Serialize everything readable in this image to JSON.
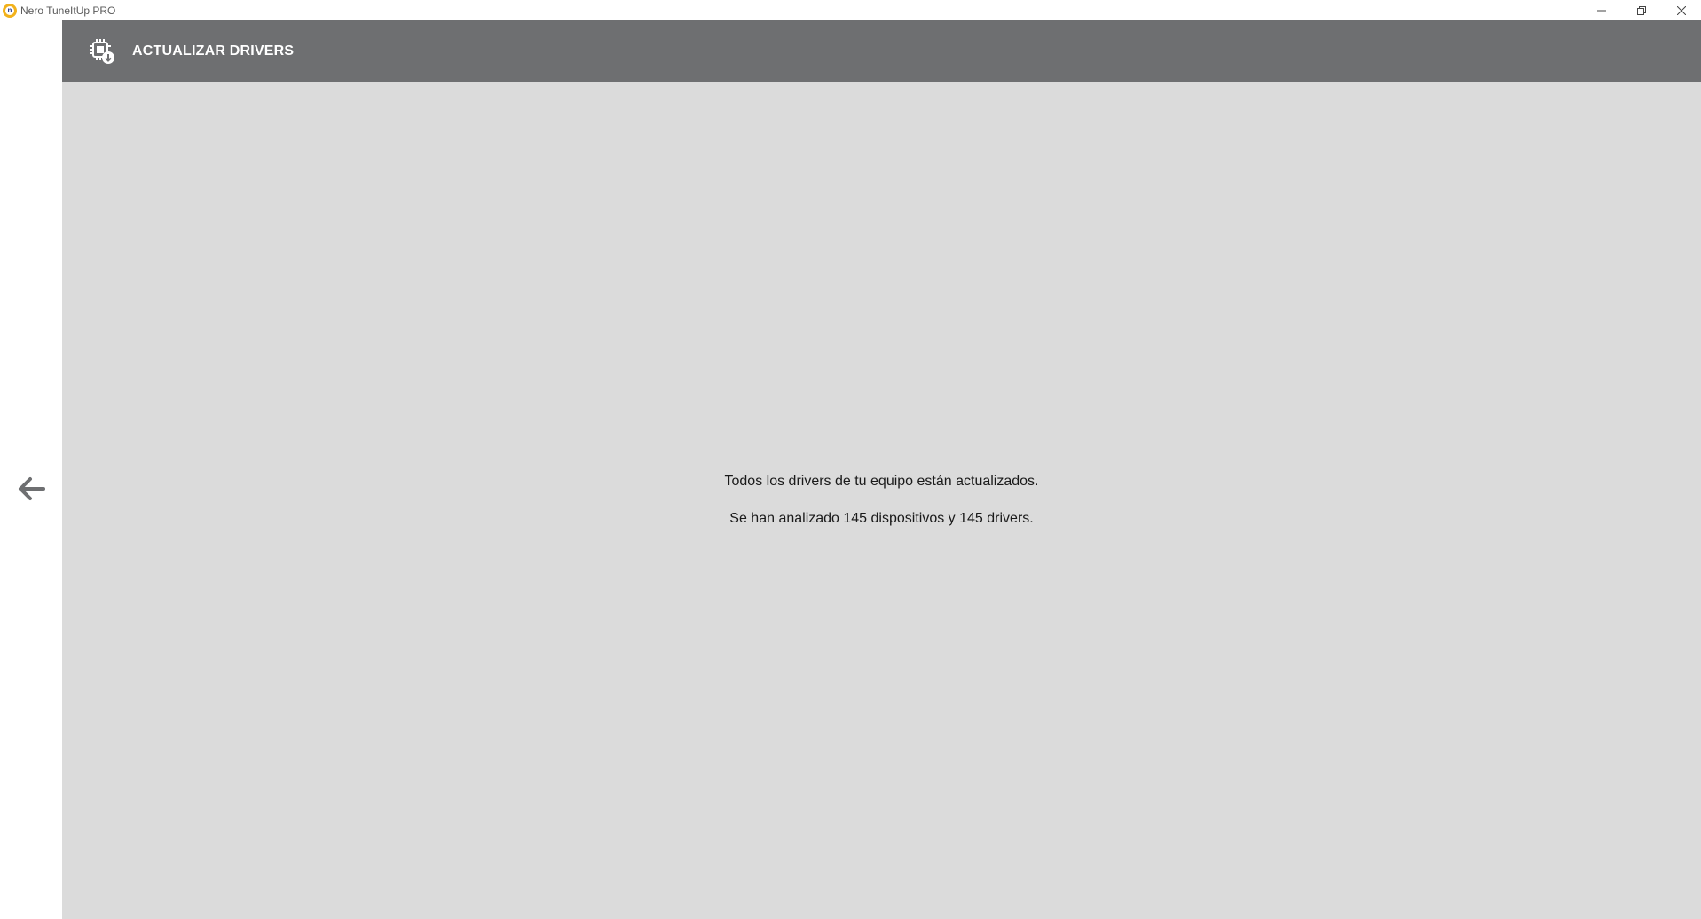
{
  "window": {
    "title": "Nero TuneItUp PRO",
    "controls": {
      "minimize": "minimize-icon",
      "restore": "restore-icon",
      "close": "close-icon"
    }
  },
  "header": {
    "title": "ACTUALIZAR DRIVERS",
    "icon": "driver-update-icon"
  },
  "navigation": {
    "back_icon": "arrow-left-icon"
  },
  "main": {
    "status_line": "Todos los drivers de tu equipo están actualizados.",
    "summary_line": "Se han analizado 145 dispositivos y 145 drivers."
  },
  "colors": {
    "header_bg": "#6e6f71",
    "content_bg": "#dbdbdb",
    "logo_accent": "#f2b21c"
  }
}
